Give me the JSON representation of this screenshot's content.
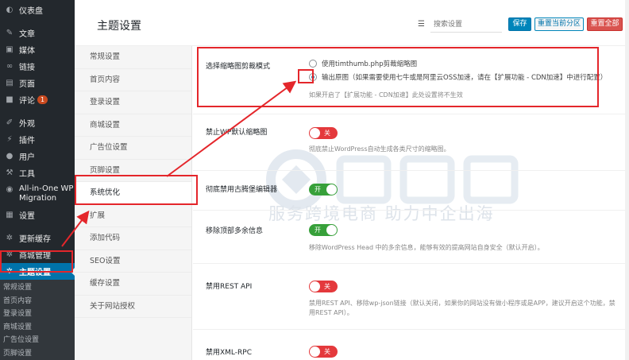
{
  "admin_menu": {
    "items": [
      {
        "label": "仪表盘",
        "icon": "dashboard-icon"
      },
      {
        "label": "文章",
        "icon": "pin-icon"
      },
      {
        "label": "媒体",
        "icon": "media-icon"
      },
      {
        "label": "链接",
        "icon": "link-icon"
      },
      {
        "label": "页面",
        "icon": "page-icon"
      },
      {
        "label": "评论",
        "icon": "comment-icon",
        "badge": "1"
      },
      {
        "label": "外观",
        "icon": "brush-icon"
      },
      {
        "label": "插件",
        "icon": "plugin-icon"
      },
      {
        "label": "用户",
        "icon": "user-icon"
      },
      {
        "label": "工具",
        "icon": "wrench-icon"
      },
      {
        "label": "All-in-One WP Migration",
        "icon": "migration-icon"
      },
      {
        "label": "设置",
        "icon": "settings-icon"
      },
      {
        "label": "更新缓存",
        "icon": "gear-icon"
      },
      {
        "label": "商城管理",
        "icon": "gear-icon"
      },
      {
        "label": "主题设置",
        "icon": "gear-icon"
      }
    ],
    "submenu": [
      "常规设置",
      "首页内容",
      "登录设置",
      "商城设置",
      "广告位设置",
      "页脚设置"
    ]
  },
  "header": {
    "title": "主题设置",
    "search_placeholder": "搜索设置",
    "save_label": "保存",
    "reset_section_label": "重置当前分区",
    "reset_all_label": "重置全部"
  },
  "tabs": [
    "常规设置",
    "首页内容",
    "登录设置",
    "商城设置",
    "广告位设置",
    "页脚设置",
    "系统优化",
    "扩展",
    "添加代码",
    "SEO设置",
    "缓存设置",
    "关于网站授权"
  ],
  "fields": {
    "thumb": {
      "label": "选择缩略图剪裁模式",
      "option1": "使用timthumb.php剪裁缩略图",
      "option2": "输出原图（如果需要使用七牛或是阿里云OSS加速，请在【扩展功能 - CDN加速】中进行配置）",
      "desc": "如果开启了【扩展功能 - CDN加速】此处设置将不生效"
    },
    "disable_thumbs": {
      "label": "禁止WP默认缩略图",
      "state": "关",
      "desc": "彻底禁止WordPress自动生成各类尺寸的缩略图。"
    },
    "classic_editor": {
      "label": "彻底禁用古腾堡编辑器",
      "state": "开"
    },
    "head_info": {
      "label": "移除顶部多余信息",
      "state": "开",
      "desc": "移除WordPress Head 中的多余信息，能够有效的提高网站自身安全（默认开启）。"
    },
    "rest_api": {
      "label": "禁用REST API",
      "state": "关",
      "desc": "禁用REST API、移除wp-json链接（默认关闭，如果你的网站没有做小程序或是APP，建议开启这个功能，禁用REST API）。"
    },
    "xml_rpc": {
      "label": "禁用XML-RPC",
      "state": "关"
    }
  },
  "watermark": {
    "text": "服务跨境电商 助力中企出海"
  },
  "colors": {
    "wp_admin_bg": "#23282d",
    "wp_blue": "#0073aa",
    "switch_off": "#e4393c",
    "switch_on": "#37a03a",
    "annotation_red": "#e4262b"
  }
}
